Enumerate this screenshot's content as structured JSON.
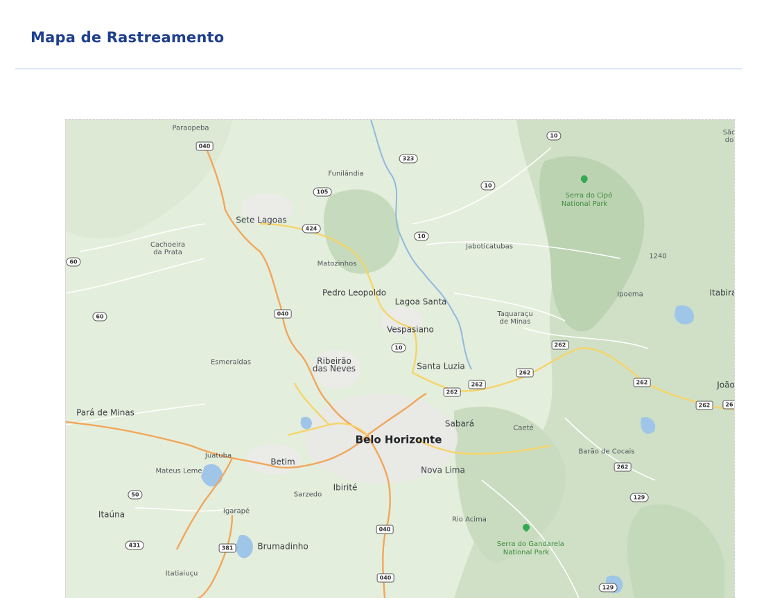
{
  "page": {
    "title": "Mapa de Rastreamento"
  },
  "map": {
    "places": [
      {
        "name": "Paraopeba",
        "kind": "small"
      },
      {
        "name": "Funilândia",
        "kind": "small"
      },
      {
        "name": "Sete Lagoas",
        "kind": "town"
      },
      {
        "name": "Cachoeira\nda Prata",
        "kind": "small"
      },
      {
        "name": "Matozinhos",
        "kind": "small"
      },
      {
        "name": "Jaboticatubas",
        "kind": "small"
      },
      {
        "name": "Pedro Leopoldo",
        "kind": "town"
      },
      {
        "name": "Lagoa Santa",
        "kind": "town"
      },
      {
        "name": "Vespasiano",
        "kind": "town"
      },
      {
        "name": "Taquaraçu\nde Minas",
        "kind": "small"
      },
      {
        "name": "Ipoema",
        "kind": "small"
      },
      {
        "name": "Itabira",
        "kind": "town"
      },
      {
        "name": "Esmeraldas",
        "kind": "small"
      },
      {
        "name": "Ribeirão\ndas Neves",
        "kind": "town"
      },
      {
        "name": "Santa Luzia",
        "kind": "town"
      },
      {
        "name": "João",
        "kind": "town"
      },
      {
        "name": "Pará de Minas",
        "kind": "town"
      },
      {
        "name": "Belo Horizonte",
        "kind": "big"
      },
      {
        "name": "Sabará",
        "kind": "town"
      },
      {
        "name": "Caeté",
        "kind": "small"
      },
      {
        "name": "Juatuba",
        "kind": "small"
      },
      {
        "name": "Betim",
        "kind": "town"
      },
      {
        "name": "Mateus Leme",
        "kind": "small"
      },
      {
        "name": "Nova Lima",
        "kind": "town"
      },
      {
        "name": "Barão de Cocais",
        "kind": "small"
      },
      {
        "name": "Sarzedo",
        "kind": "small"
      },
      {
        "name": "Ibirité",
        "kind": "town"
      },
      {
        "name": "Itaúna",
        "kind": "town"
      },
      {
        "name": "Igarapé",
        "kind": "small"
      },
      {
        "name": "Rio Acima",
        "kind": "small"
      },
      {
        "name": "Brumadinho",
        "kind": "town"
      },
      {
        "name": "Itatiaiuçu",
        "kind": "small"
      },
      {
        "name": "São\ndo",
        "kind": "small"
      },
      {
        "name": "1240",
        "kind": "small"
      }
    ],
    "parks": [
      {
        "name": "Serra do Cipó\nNational Park"
      },
      {
        "name": "Serra do Gandarela\nNational Park"
      }
    ],
    "shields": [
      "040",
      "323",
      "10",
      "105",
      "10",
      "424",
      "10",
      "60",
      "60",
      "040",
      "10",
      "262",
      "262",
      "262",
      "262",
      "262",
      "262",
      "262",
      "26",
      "50",
      "431",
      "381",
      "040",
      "040",
      "129",
      "129"
    ]
  }
}
